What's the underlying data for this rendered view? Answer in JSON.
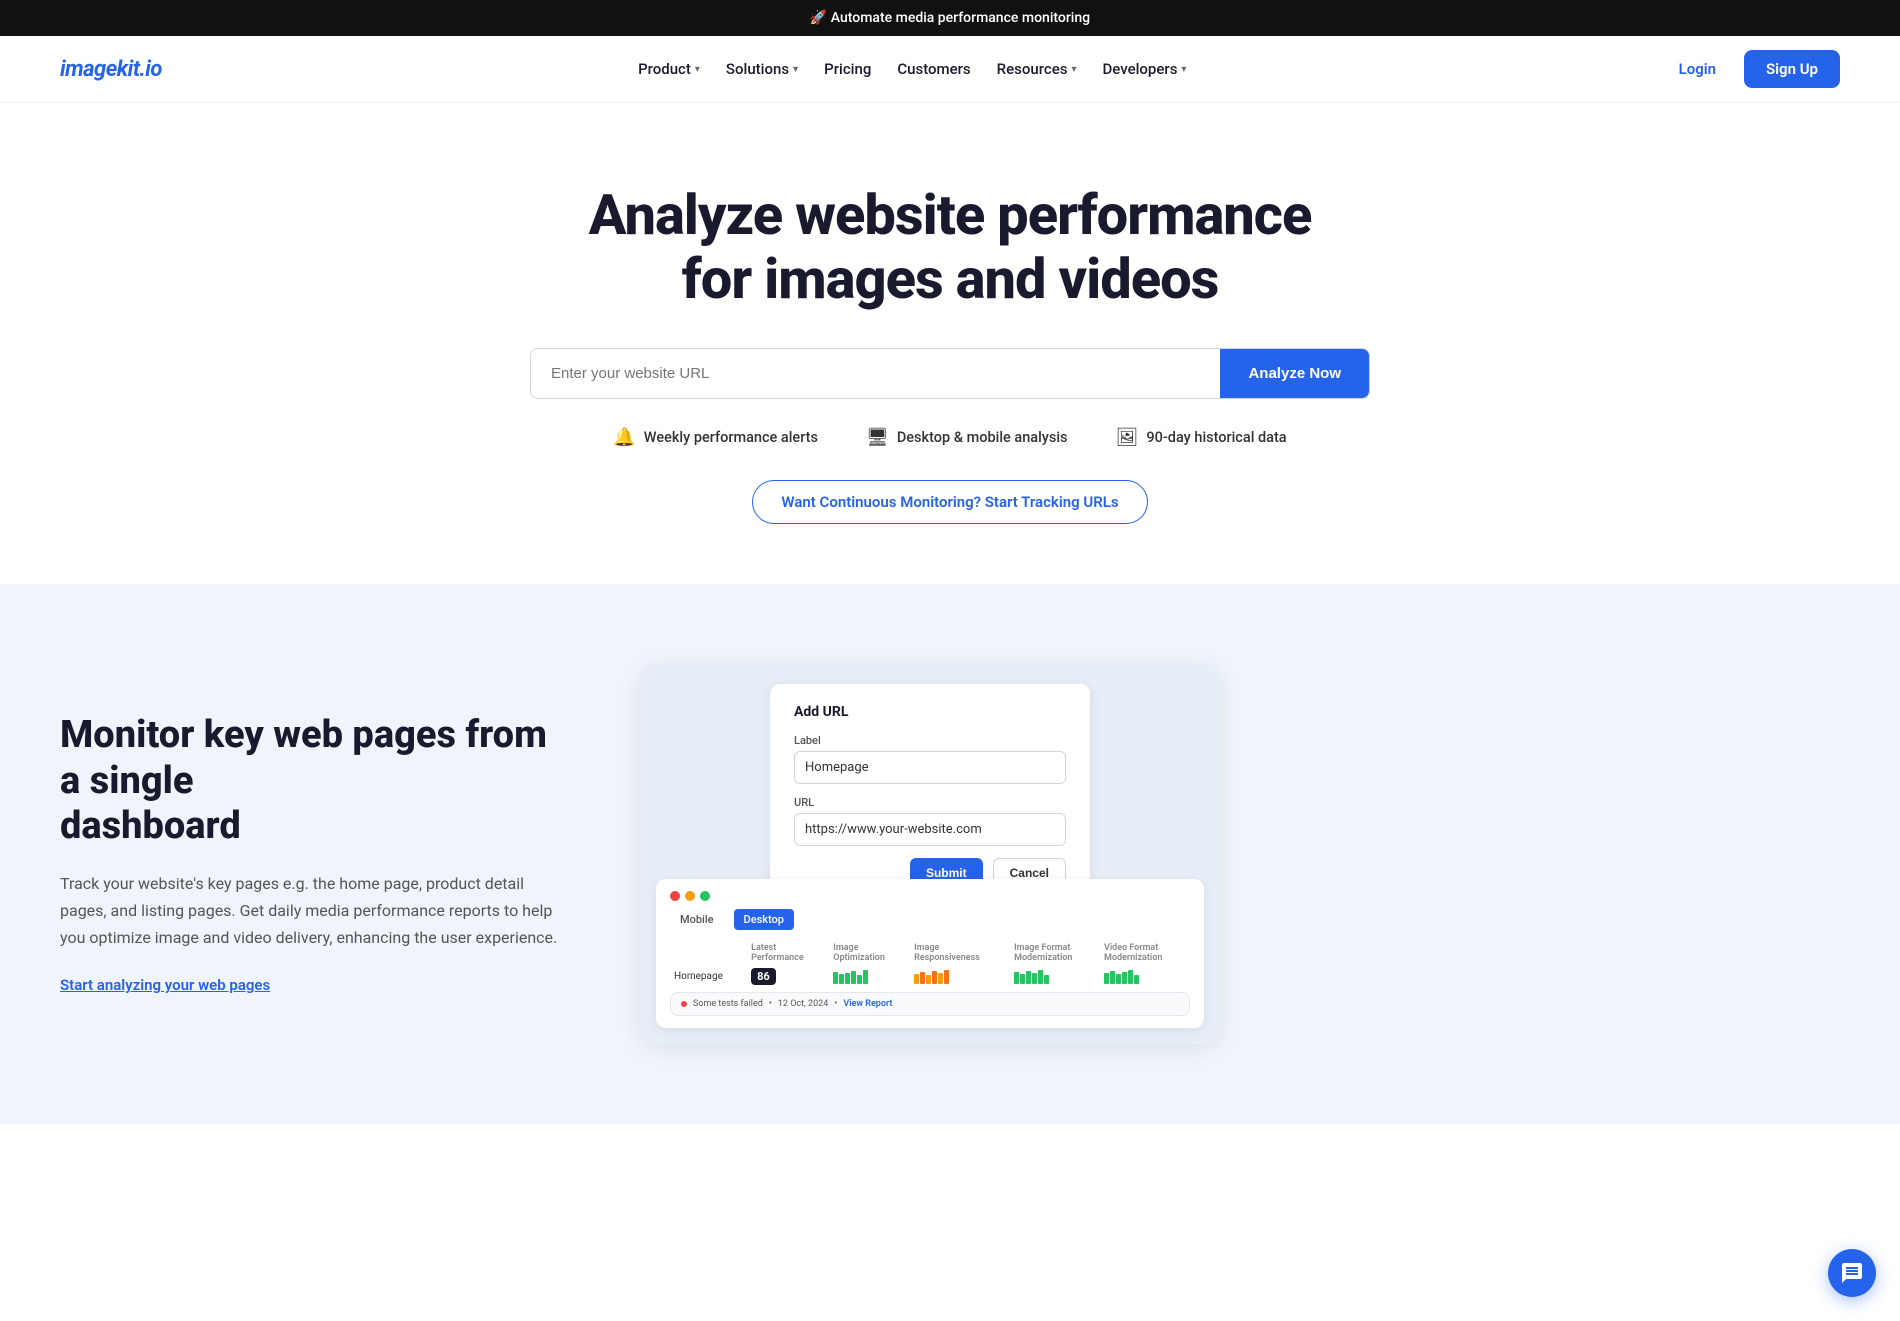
{
  "banner": {
    "text": "🚀 Automate media performance monitoring"
  },
  "nav": {
    "logo": "imagekit.io",
    "links": [
      {
        "label": "Product",
        "has_dropdown": true
      },
      {
        "label": "Solutions",
        "has_dropdown": true
      },
      {
        "label": "Pricing",
        "has_dropdown": false
      },
      {
        "label": "Customers",
        "has_dropdown": false
      },
      {
        "label": "Resources",
        "has_dropdown": true
      },
      {
        "label": "Developers",
        "has_dropdown": true
      }
    ],
    "login_label": "Login",
    "signup_label": "Sign Up"
  },
  "hero": {
    "heading_line1": "Analyze website performance",
    "heading_line2": "for images and videos",
    "input_placeholder": "Enter your website URL",
    "analyze_button": "Analyze Now",
    "features": [
      {
        "icon": "🔔",
        "label": "Weekly performance alerts"
      },
      {
        "icon": "🖥",
        "label": "Desktop & mobile analysis"
      },
      {
        "icon": "🖼",
        "label": "90-day historical data"
      }
    ],
    "cta_label": "Want Continuous Monitoring? Start Tracking URLs"
  },
  "section": {
    "heading_line1": "Monitor key web pages from a single",
    "heading_line2": "dashboard",
    "description": "Track your website's key pages e.g. the home page, product detail pages, and listing pages. Get daily media performance reports to help you optimize image and video delivery, enhancing the user experience.",
    "link_label": "Start analyzing your web pages"
  },
  "mockup": {
    "card": {
      "title": "Add URL",
      "label_label": "Label",
      "label_value": "Homepage",
      "url_label": "URL",
      "url_value": "https://www.your-website.com",
      "submit_label": "Submit",
      "cancel_label": "Cancel"
    },
    "table_card": {
      "tabs": [
        "Mobile",
        "Desktop"
      ],
      "active_tab": "Desktop",
      "columns": [
        "",
        "Latest Performance",
        "Image Optimization",
        "Image Responsiveness",
        "Image Format Modernization",
        "Video Format Modernization"
      ],
      "rows": [
        {
          "label": "Homepage",
          "score": "86",
          "bars_img_opt": "green",
          "bars_img_resp": "mixed",
          "bars_img_fmt": "green",
          "bars_vid_fmt": "green"
        }
      ],
      "tooltip_text": "Some tests failed",
      "tooltip_date": "12 Oct, 2024",
      "tooltip_link": "View Report"
    }
  }
}
